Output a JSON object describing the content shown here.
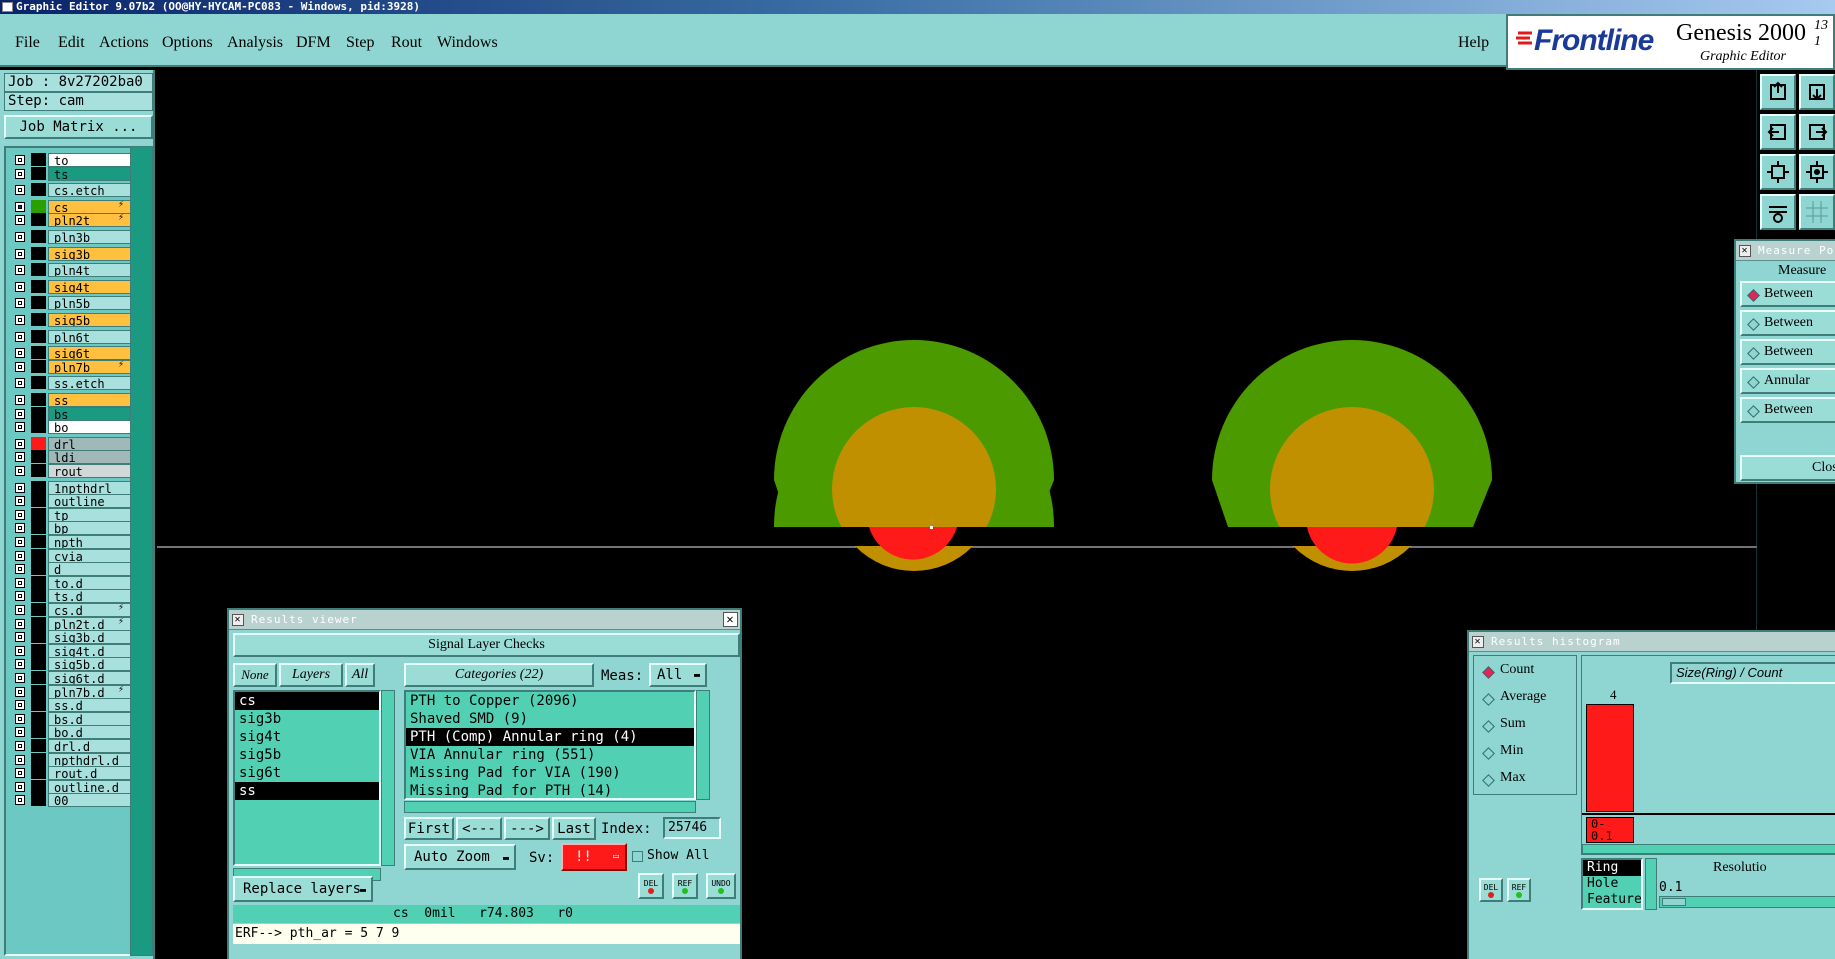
{
  "titlebar": {
    "text": "Graphic Editor 9.07b2 (OO@HY-HYCAM-PC083 - Windows, pid:3928)"
  },
  "menu": [
    "File",
    "Edit",
    "Actions",
    "Options",
    "Analysis",
    "DFM",
    "Step",
    "Rout",
    "Windows"
  ],
  "help_label": "Help",
  "logo": {
    "brand": "Frontline",
    "product": "Genesis 2000",
    "version": "13",
    "subtitle": "Graphic Editor",
    "suffix": "1"
  },
  "job": {
    "job_label": "Job : 8v27202ba0",
    "step_label": "Step: cam",
    "matrix_button": "Job Matrix ..."
  },
  "colors": {
    "green": "#4a9a00",
    "orange": "#c09000",
    "red": "#ff1a1a",
    "teal": "#8fd6d2",
    "list_bg": "#52d0b4",
    "yellow_layer": "#ffc040",
    "dark_teal": "#1a9a80"
  },
  "layers": [
    {
      "name": "to",
      "color": "#ffffff"
    },
    {
      "name": "ts",
      "color": "#1a9a80"
    },
    {
      "name": "cs.etch",
      "color": "#a7e0dc"
    },
    {
      "name": "cs",
      "color": "#ffc040"
    },
    {
      "name": "pln2t",
      "color": "#ffc040"
    },
    {
      "name": "pln3b",
      "color": "#a7e0dc"
    },
    {
      "name": "sig3b",
      "color": "#ffc040"
    },
    {
      "name": "pln4t",
      "color": "#a7e0dc"
    },
    {
      "name": "sig4t",
      "color": "#ffc040"
    },
    {
      "name": "pln5b",
      "color": "#a7e0dc"
    },
    {
      "name": "sig5b",
      "color": "#ffc040"
    },
    {
      "name": "pln6t",
      "color": "#a7e0dc"
    },
    {
      "name": "sig6t",
      "color": "#ffc040"
    },
    {
      "name": "pln7b",
      "color": "#ffc040"
    },
    {
      "name": "ss.etch",
      "color": "#a7e0dc"
    },
    {
      "name": "ss",
      "color": "#ffc040"
    },
    {
      "name": "bs",
      "color": "#1a9a80"
    },
    {
      "name": "bo",
      "color": "#ffffff"
    },
    {
      "name": "drl",
      "color": "#a0b8b8"
    },
    {
      "name": "ldi",
      "color": "#a0b8b8"
    },
    {
      "name": "rout",
      "color": "#d0d8d8"
    },
    {
      "name": "1npthdrl",
      "color": "#a7e0dc"
    },
    {
      "name": "outline",
      "color": "#a7e0dc"
    },
    {
      "name": "tp",
      "color": "#a7e0dc"
    },
    {
      "name": "bp",
      "color": "#a7e0dc"
    },
    {
      "name": "npth",
      "color": "#a7e0dc"
    },
    {
      "name": "cvia",
      "color": "#a7e0dc"
    },
    {
      "name": "d",
      "color": "#a7e0dc"
    },
    {
      "name": "to.d",
      "color": "#a7e0dc"
    },
    {
      "name": "ts.d",
      "color": "#a7e0dc"
    },
    {
      "name": "cs.d",
      "color": "#a7e0dc"
    },
    {
      "name": "pln2t.d",
      "color": "#a7e0dc"
    },
    {
      "name": "sig3b.d",
      "color": "#a7e0dc"
    },
    {
      "name": "sig4t.d",
      "color": "#a7e0dc"
    },
    {
      "name": "sig5b.d",
      "color": "#a7e0dc"
    },
    {
      "name": "sig6t.d",
      "color": "#a7e0dc"
    },
    {
      "name": "pln7b.d",
      "color": "#a7e0dc"
    },
    {
      "name": "ss.d",
      "color": "#a7e0dc"
    },
    {
      "name": "bs.d",
      "color": "#a7e0dc"
    },
    {
      "name": "bo.d",
      "color": "#a7e0dc"
    },
    {
      "name": "drl.d",
      "color": "#a7e0dc"
    },
    {
      "name": "npthdrl.d",
      "color": "#a7e0dc"
    },
    {
      "name": "rout.d",
      "color": "#a7e0dc"
    },
    {
      "name": "outline.d",
      "color": "#a7e0dc"
    },
    {
      "name": "00",
      "color": "#a7e0dc"
    }
  ],
  "results_viewer": {
    "title": "Results viewer",
    "header": "Signal Layer Checks",
    "none_btn": "None",
    "layers_btn": "Layers",
    "all_btn": "All",
    "categories_btn": "Categories (22)",
    "meas_label": "Meas:",
    "meas_value": "All",
    "layers_list": [
      "cs",
      "sig3b",
      "sig4t",
      "sig5b",
      "sig6t",
      "ss"
    ],
    "categories": [
      "PTH to Copper (2096)",
      "Shaved SMD (9)",
      "PTH (Comp) Annular ring (4)",
      "VIA Annular ring (551)",
      "Missing Pad for VIA (190)",
      "Missing Pad for PTH (14)"
    ],
    "first_btn": "First",
    "prev_btn": "<---",
    "next_btn": "--->",
    "last_btn": "Last",
    "index_label": "Index:",
    "index_value": "25746",
    "auto_zoom": "Auto Zoom",
    "sv_label": "Sv:",
    "sv_value": "!!",
    "show_all": "Show All",
    "replace_layers": "Replace layers",
    "status": "cs  0mil   r74.803   r0",
    "erf": "ERF--> pth_ar = 5 7 9",
    "del": "DEL",
    "ref": "REF",
    "undo": "UNDO"
  },
  "measure": {
    "title": "Measure Pop",
    "header": "Measure",
    "options": [
      "Between",
      "Between",
      "Between",
      "Annular",
      "Between"
    ],
    "close": "Clos"
  },
  "histogram": {
    "title": "Results histogram",
    "options": [
      "Count",
      "Average",
      "Sum",
      "Min",
      "Max"
    ],
    "header": "Size(Ring) / Count",
    "bar_value": "4",
    "bar_label": "0-\n0.1",
    "list": [
      "Ring",
      "Hole",
      "Feature"
    ],
    "resolution_label": "Resolutio",
    "resolution_value": "0.1",
    "del": "DEL",
    "ref": "REF"
  }
}
